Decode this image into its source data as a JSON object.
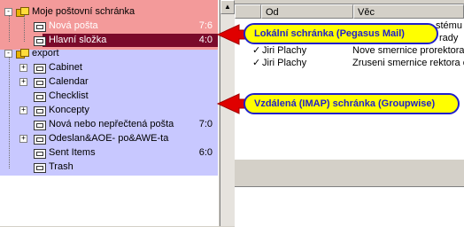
{
  "folder_tree": {
    "local_root": {
      "label": "Moje poštovní schránka"
    },
    "local_items": [
      {
        "label": "Nová pošta",
        "count": "7:6"
      },
      {
        "label": "Hlavní složka",
        "count": "4:0"
      }
    ],
    "imap_root": {
      "label": "export"
    },
    "imap_items": [
      {
        "label": "Cabinet",
        "count": ""
      },
      {
        "label": "Calendar",
        "count": ""
      },
      {
        "label": "Checklist",
        "count": ""
      },
      {
        "label": "Koncepty",
        "count": ""
      },
      {
        "label": "Nová nebo nepřečtená pošta",
        "count": "7:0"
      },
      {
        "label": "Odeslan&AOE- po&AWE-ta",
        "count": ""
      },
      {
        "label": "Sent Items",
        "count": "6:0"
      },
      {
        "label": "Trash",
        "count": ""
      }
    ]
  },
  "message_list": {
    "columns": [
      "",
      "Od",
      "Věc"
    ],
    "rows": [
      {
        "check": "",
        "from": "",
        "subject": "stému"
      },
      {
        "check": "",
        "from": "",
        "subject": "rady"
      },
      {
        "check": "✓",
        "from": "Jiri Plachy",
        "subject": "Nove smernice prorektora"
      },
      {
        "check": "✓",
        "from": "Jiri Plachy",
        "subject": "Zruseni smernice rektora c"
      }
    ]
  },
  "callouts": {
    "local": "Lokální schránka (Pegasus Mail)",
    "imap": "Vzdálená (IMAP) schránka (Groupwise)"
  },
  "colors": {
    "local_highlight": "#f39a9a",
    "imap_highlight": "#c8c8ff",
    "callout_fill": "#ffff00",
    "callout_text": "#1f1fcc",
    "arrow": "#e00000"
  }
}
